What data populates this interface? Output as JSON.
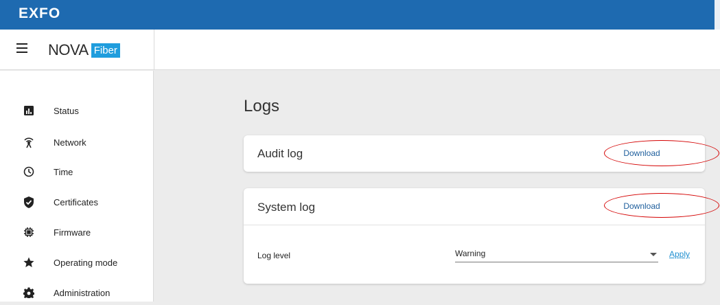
{
  "brand": "EXFO",
  "logo": {
    "nova": "NOVA",
    "fiber": "Fiber"
  },
  "sidebar": {
    "items": [
      {
        "label": "Status",
        "icon": "bar-chart-icon"
      },
      {
        "label": "Network",
        "icon": "antenna-icon"
      },
      {
        "label": "Time",
        "icon": "clock-icon"
      },
      {
        "label": "Certificates",
        "icon": "shield-check-icon"
      },
      {
        "label": "Firmware",
        "icon": "chip-icon"
      },
      {
        "label": "Operating mode",
        "icon": "star-icon"
      },
      {
        "label": "Administration",
        "icon": "gear-icon"
      }
    ]
  },
  "main": {
    "title": "Logs",
    "audit": {
      "title": "Audit log",
      "download_label": "Download"
    },
    "system": {
      "title": "System log",
      "download_label": "Download",
      "log_level_label": "Log level",
      "log_level_value": "Warning",
      "apply_label": "Apply"
    }
  },
  "colors": {
    "topbar": "#1e6ab0",
    "accent": "#1f9ddd",
    "highlight_ring": "#d40000"
  }
}
